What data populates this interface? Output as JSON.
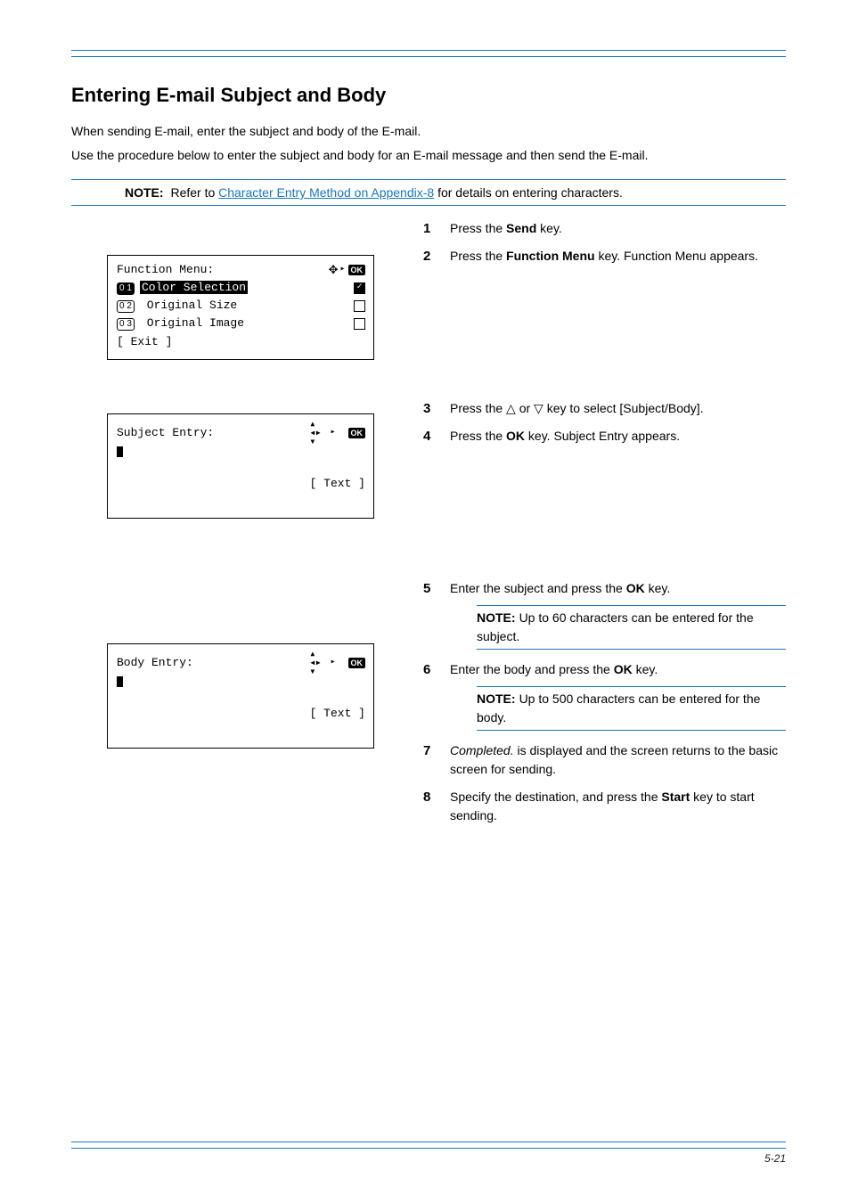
{
  "header": {
    "title": "Entering E-mail Subject and Body"
  },
  "intro": {
    "p1": "When sending E-mail, enter the subject and body of the E-mail.",
    "p2": "Use the procedure below to enter the subject and body for an E-mail message and then send the E-mail."
  },
  "note_main": {
    "label": "NOTE:",
    "before_link": "Refer to ",
    "link_text": "Character Entry Method on Appendix-8",
    "after_link": " for details on entering characters."
  },
  "lcd1": {
    "title": "Function Menu:",
    "item1_num": "0 1",
    "item1_text": "Color Selection",
    "item2_num": "0 2",
    "item2_text": " Original Size",
    "item3_num": "0 3",
    "item3_text": " Original Image",
    "footer_left": "[ Exit ]"
  },
  "lcd2": {
    "title": "Subject Entry:",
    "footer_left": "",
    "footer_right": "[ Text ]"
  },
  "lcd3": {
    "title": "Body Entry:",
    "footer_left": "",
    "footer_right": "[ Text ]"
  },
  "steps": {
    "s1_a": "Press the ",
    "s1_key": "Send",
    "s1_b": " key.",
    "s2_a": "Press the ",
    "s2_key": "Function Menu",
    "s2_b": " key. Function Menu appears.",
    "s3_a": "Press the ",
    "s3_b": " or ",
    "s3_c": " key to select [Subject/Body].",
    "s4_a": "Press the ",
    "s4_key": "OK",
    "s4_b": " key. Subject Entry appears.",
    "s5_a": "Enter the subject and press the ",
    "s5_key": "OK",
    "s5_b": " key.",
    "note_sub_label": "NOTE:",
    "note_sub_text": "Up to 60 characters can be entered for the subject.",
    "s6_a": "Enter the body and press the ",
    "s6_key": "OK",
    "s6_b": " key.",
    "note_body_label": "NOTE:",
    "note_body_text": "Up to 500 characters can be entered for the body.",
    "s7_a": "Completed.",
    "s7_b": " is displayed and the screen returns to the basic screen for sending.",
    "s8_a": "Specify the destination, and press the ",
    "s8_key": "Start",
    "s8_b": " key to start sending."
  },
  "footer": {
    "text": "5-21"
  }
}
